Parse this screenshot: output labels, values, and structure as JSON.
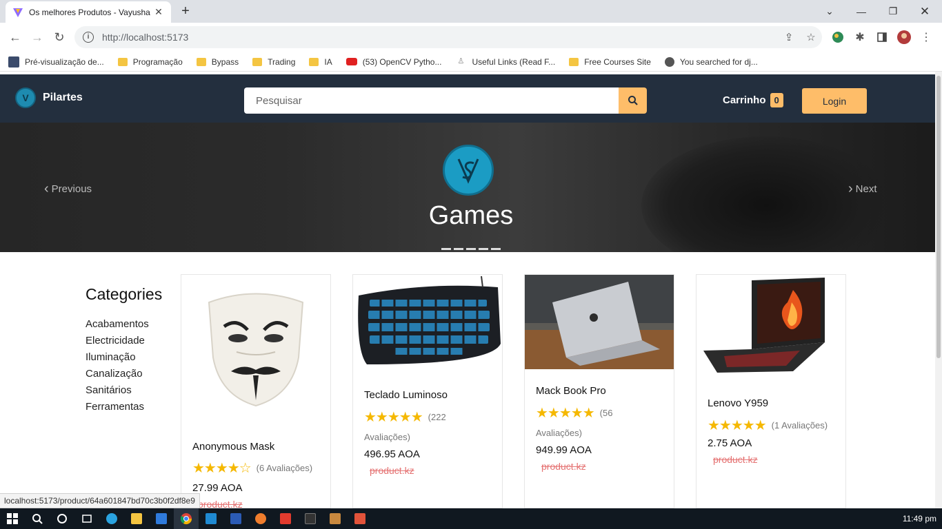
{
  "browser": {
    "tab_title": "Os melhores Produtos - Vayusha",
    "url": "http://localhost:5173",
    "bookmarks": [
      {
        "label": "Pré-visualização de...",
        "icon": "site-icon"
      },
      {
        "label": "Programação",
        "icon": "folder-icon"
      },
      {
        "label": "Bypass",
        "icon": "folder-icon"
      },
      {
        "label": "Trading",
        "icon": "folder-icon"
      },
      {
        "label": "IA",
        "icon": "folder-icon"
      },
      {
        "label": "(53) OpenCV Pytho...",
        "icon": "youtube-icon"
      },
      {
        "label": "Useful Links (Read F...",
        "icon": "site-icon"
      },
      {
        "label": "Free Courses Site",
        "icon": "folder-icon"
      },
      {
        "label": "You searched for dj...",
        "icon": "globe-icon"
      }
    ],
    "status_url": "localhost:5173/product/64a601847bd70c3b0f2df8e9"
  },
  "navbar": {
    "brand": "Pilartes",
    "search_placeholder": "Pesquisar",
    "cart_label": "Carrinho",
    "cart_count": "0",
    "login_label": "Login"
  },
  "hero": {
    "title": "Games",
    "prev_label": "Previous",
    "next_label": "Next"
  },
  "categories": {
    "title": "Categories",
    "items": [
      "Acabamentos",
      "Electricidade",
      "Iluminação",
      "Canalização",
      "Sanitários",
      "Ferramentas"
    ]
  },
  "products": [
    {
      "name": "Anonymous Mask",
      "rating": 4,
      "reviews": "(6 Avaliações)",
      "price": "27.99 AOA",
      "seller": "product.kz"
    },
    {
      "name": "Teclado Luminoso",
      "rating": 5,
      "reviews": "(222",
      "reviews_cont": "Avaliações)",
      "price": "496.95 AOA",
      "seller": "product.kz"
    },
    {
      "name": "Mack Book Pro",
      "rating": 5,
      "reviews": "(56",
      "reviews_cont": "Avaliações)",
      "price": "949.99 AOA",
      "seller": "product.kz"
    },
    {
      "name": "Lenovo Y959",
      "rating": 5,
      "reviews": "(1 Avaliações)",
      "price": "2.75 AOA",
      "seller": "product.kz"
    }
  ],
  "taskbar": {
    "clock": "11:49 pm"
  },
  "colors": {
    "navbar": "#232f3e",
    "accent": "#febd69",
    "star": "#f5b800",
    "seller": "#e57373"
  }
}
